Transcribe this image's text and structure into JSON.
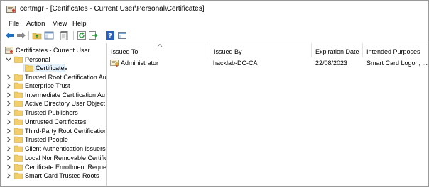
{
  "window": {
    "title": "certmgr - [Certificates - Current User\\Personal\\Certificates]"
  },
  "menu": [
    "File",
    "Action",
    "View",
    "Help"
  ],
  "toolbar": {
    "buttons": [
      "back-icon",
      "forward-icon",
      "up-folder-icon",
      "show-hide-tree-icon",
      "properties-icon",
      "refresh-icon",
      "export-list-icon",
      "help-icon",
      "view-icon"
    ]
  },
  "tree": {
    "root": "Certificates - Current User",
    "items": [
      {
        "label": "Personal",
        "expanded": true
      },
      {
        "label": "Certificates",
        "selected": true
      },
      {
        "label": "Trusted Root Certification Au"
      },
      {
        "label": "Enterprise Trust"
      },
      {
        "label": "Intermediate Certification Au"
      },
      {
        "label": "Active Directory User Object"
      },
      {
        "label": "Trusted Publishers"
      },
      {
        "label": "Untrusted Certificates"
      },
      {
        "label": "Third-Party Root Certification"
      },
      {
        "label": "Trusted People"
      },
      {
        "label": "Client Authentication Issuers"
      },
      {
        "label": "Local NonRemovable Certific"
      },
      {
        "label": "Certificate Enrollment Reques"
      },
      {
        "label": "Smart Card Trusted Roots"
      }
    ]
  },
  "list": {
    "columns": [
      "Issued To",
      "Issued By",
      "Expiration Date",
      "Intended Purposes"
    ],
    "rows": [
      {
        "issued_to": "Administrator",
        "issued_by": "hacklab-DC-CA",
        "expiration": "22/08/2023",
        "purposes": "Smart Card Logon, ..."
      }
    ]
  }
}
